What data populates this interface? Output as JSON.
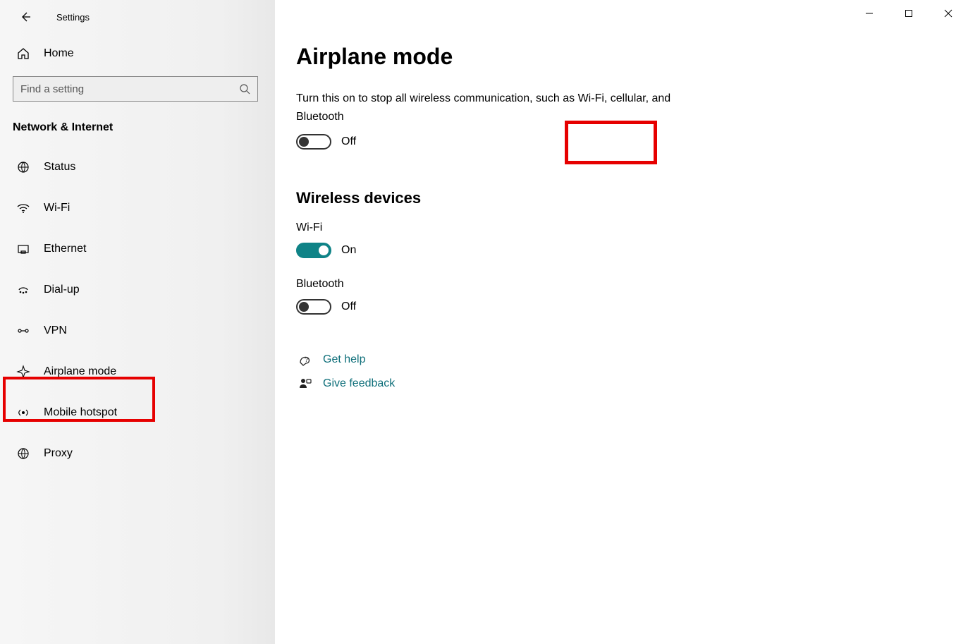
{
  "app_title": "Settings",
  "home_label": "Home",
  "search_placeholder": "Find a setting",
  "category": "Network & Internet",
  "sidebar": {
    "items": [
      {
        "label": "Status",
        "icon": "status-icon"
      },
      {
        "label": "Wi-Fi",
        "icon": "wifi-icon"
      },
      {
        "label": "Ethernet",
        "icon": "ethernet-icon"
      },
      {
        "label": "Dial-up",
        "icon": "dialup-icon"
      },
      {
        "label": "VPN",
        "icon": "vpn-icon"
      },
      {
        "label": "Airplane mode",
        "icon": "airplane-icon"
      },
      {
        "label": "Mobile hotspot",
        "icon": "hotspot-icon"
      },
      {
        "label": "Proxy",
        "icon": "proxy-icon"
      }
    ]
  },
  "page": {
    "title": "Airplane mode",
    "description": "Turn this on to stop all wireless communication, such as Wi-Fi, cellular, and Bluetooth",
    "airplane_toggle_state": "Off",
    "wireless_section": "Wireless devices",
    "devices": [
      {
        "name": "Wi-Fi",
        "state": "On",
        "on": true
      },
      {
        "name": "Bluetooth",
        "state": "Off",
        "on": false
      }
    ],
    "help_label": "Get help",
    "feedback_label": "Give feedback"
  },
  "window_controls": {
    "minimize": "−",
    "maximize": "□",
    "close": "✕"
  }
}
